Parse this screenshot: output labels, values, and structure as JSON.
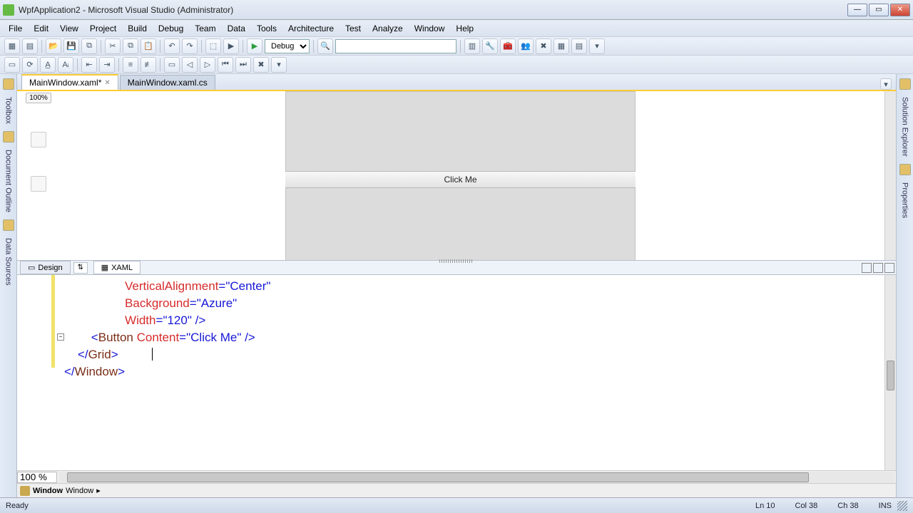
{
  "title": "WpfApplication2 - Microsoft Visual Studio (Administrator)",
  "menu": [
    "File",
    "Edit",
    "View",
    "Project",
    "Build",
    "Debug",
    "Team",
    "Data",
    "Tools",
    "Architecture",
    "Test",
    "Analyze",
    "Window",
    "Help"
  ],
  "config": "Debug",
  "docTabs": {
    "active": "MainWindow.xaml*",
    "other": "MainWindow.xaml.cs"
  },
  "designer": {
    "zoomBadge": "100%",
    "buttonContent": "Click Me"
  },
  "splitTabs": {
    "design": "Design",
    "xaml": "XAML"
  },
  "code": {
    "l1_attr": "VerticalAlignment",
    "l1_val": "\"Center\"",
    "l2_attr": "Background",
    "l2_val": "\"Azure\"",
    "l3_attr": "Width",
    "l3_val": "\"120\"",
    "l3_close": " />",
    "l4_open": "<",
    "l4_tag": "Button",
    "l4_attr": "Content",
    "l4_val": "\"Click Me\"",
    "l4_close": " />",
    "l5": "</Grid>",
    "l6": "</Window>"
  },
  "editorZoom": "100 %",
  "breadcrumb": {
    "b1": "Window",
    "b2": "Window"
  },
  "status": {
    "ready": "Ready",
    "ln": "Ln 10",
    "col": "Col 38",
    "ch": "Ch 38",
    "ins": "INS"
  },
  "leftRail": [
    "Toolbox",
    "Document Outline",
    "Data Sources"
  ],
  "rightRail": [
    "Solution Explorer",
    "Properties"
  ]
}
